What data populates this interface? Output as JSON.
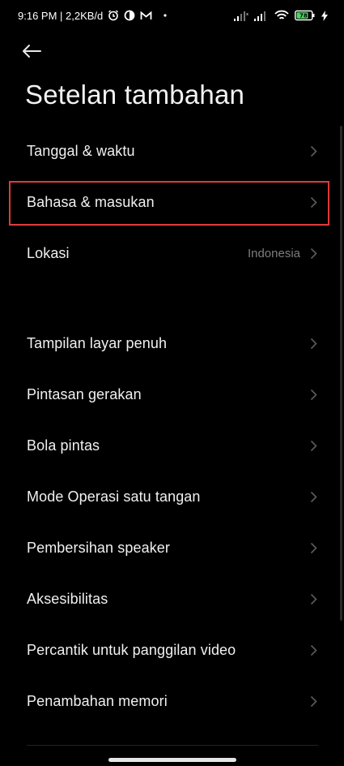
{
  "status_bar": {
    "time_speed": "9:16 PM | 2,2KB/d",
    "battery_level": "78"
  },
  "page": {
    "title": "Setelan tambahan"
  },
  "section1": [
    {
      "label": "Tanggal & waktu",
      "value": ""
    },
    {
      "label": "Bahasa & masukan",
      "value": "",
      "highlighted": true
    },
    {
      "label": "Lokasi",
      "value": "Indonesia"
    }
  ],
  "section2": [
    {
      "label": "Tampilan layar penuh"
    },
    {
      "label": "Pintasan gerakan"
    },
    {
      "label": "Bola pintas"
    },
    {
      "label": "Mode Operasi satu tangan"
    },
    {
      "label": "Pembersihan speaker"
    },
    {
      "label": "Aksesibilitas"
    },
    {
      "label": "Percantik untuk panggilan video"
    },
    {
      "label": "Penambahan memori"
    }
  ],
  "colors": {
    "background": "#000000",
    "highlight": "#e03a3a",
    "battery": "#4cd964"
  }
}
